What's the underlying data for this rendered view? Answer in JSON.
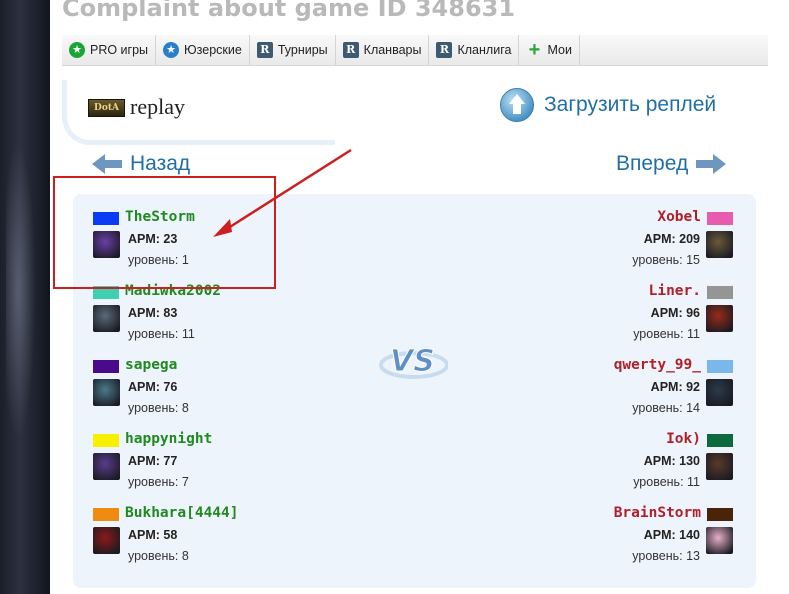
{
  "page": {
    "title": "Complaint about game ID 348631"
  },
  "nav": {
    "items": [
      {
        "label": "PRO игры",
        "icon": "star-circle-green-icon",
        "glyph": "★"
      },
      {
        "label": "Юзерские",
        "icon": "star-circle-blue-icon",
        "glyph": "★"
      },
      {
        "label": "Турниры",
        "icon": "r-badge-icon",
        "glyph": "R"
      },
      {
        "label": "Кланвары",
        "icon": "r-badge-icon",
        "glyph": "R"
      },
      {
        "label": "Клан­лига",
        "icon": "r-badge-icon",
        "glyph": "R"
      },
      {
        "label": "Мои",
        "icon": "plus-icon",
        "glyph": "+"
      }
    ]
  },
  "replay": {
    "logo_text": "DotA",
    "label": "replay",
    "upload_label": "Загрузить реплей"
  },
  "navigation": {
    "back_label": "Назад",
    "forward_label": "Вперед"
  },
  "vs_label": "VS",
  "annotation": {
    "highlight_color": "#cc1f1f"
  },
  "colors": {
    "link_blue": "#1f6ea8",
    "sentinel_name": "#1f8a1f",
    "scourge_name": "#b0202a",
    "panel_bg": "#eef4fb"
  },
  "players": {
    "left": [
      {
        "name": "TheStorm",
        "color": "#0a3cf5",
        "apm": "APM: 23",
        "level": "уровень: 1",
        "hero": "#6a3fa8"
      },
      {
        "name": "Madiwka2002",
        "color": "#3fd0b4",
        "apm": "APM: 83",
        "level": "уровень: 11",
        "hero": "#5a6a7a"
      },
      {
        "name": "sapega",
        "color": "#4a0a8c",
        "apm": "APM: 76",
        "level": "уровень: 8",
        "hero": "#4a7a8a"
      },
      {
        "name": "happynight",
        "color": "#f8f000",
        "apm": "APM: 77",
        "level": "уровень: 7",
        "hero": "#5a3c8c"
      },
      {
        "name": "Bukhara[4444]",
        "color": "#f08a10",
        "apm": "APM: 58",
        "level": "уровень: 8",
        "hero": "#8a1a1a"
      }
    ],
    "right": [
      {
        "name": "Xobel",
        "color": "#e85cb0",
        "apm": "APM: 209",
        "level": "уровень: 15",
        "hero": "#6a5a3a"
      },
      {
        "name": "Liner.",
        "color": "#959595",
        "apm": "APM: 96",
        "level": "уровень: 11",
        "hero": "#9a2a1a"
      },
      {
        "name": "qwerty_99_",
        "color": "#7ab8ec",
        "apm": "APM: 92",
        "level": "уровень: 14",
        "hero": "#2a3a4a"
      },
      {
        "name": "Iok)",
        "color": "#0d6a3e",
        "apm": "APM: 130",
        "level": "уровень: 11",
        "hero": "#5a3a2a"
      },
      {
        "name": "BrainStorm",
        "color": "#4a2408",
        "apm": "APM: 140",
        "level": "уровень: 13",
        "hero": "#e8b0c8"
      }
    ]
  }
}
